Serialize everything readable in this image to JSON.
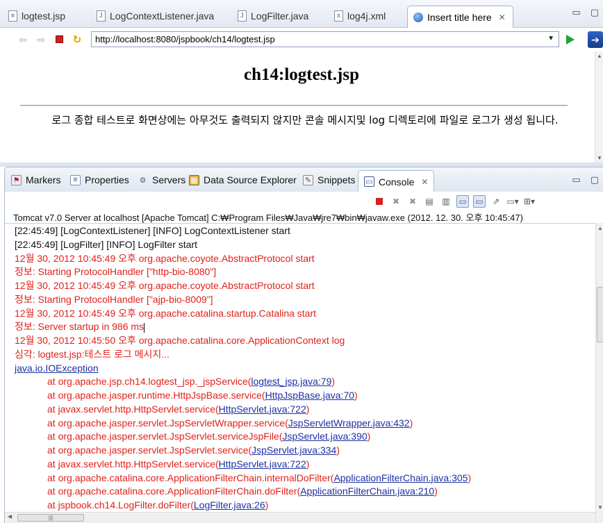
{
  "editor_tabs": [
    {
      "label": "logtest.jsp",
      "icon": "jsp-file-icon"
    },
    {
      "label": "LogContextListener.java",
      "icon": "java-file-icon"
    },
    {
      "label": "LogFilter.java",
      "icon": "java-file-icon"
    },
    {
      "label": "log4j.xml",
      "icon": "xml-file-icon"
    },
    {
      "label": "Insert title here",
      "icon": "globe-icon",
      "active": true
    }
  ],
  "browser": {
    "url": "http://localhost:8080/jspbook/ch14/logtest.jsp"
  },
  "web_page": {
    "title": "ch14:logtest.jsp",
    "message": "로그 종합 테스트로 화면상에는 아무것도 출력되지 않지만 콘솔 메시지및 log 디렉토리에 파일로 로그가 생성 됩니다."
  },
  "view_tabs": [
    {
      "label": "Markers",
      "icon": "markers-icon"
    },
    {
      "label": "Properties",
      "icon": "properties-icon"
    },
    {
      "label": "Servers",
      "icon": "servers-icon"
    },
    {
      "label": "Data Source Explorer",
      "icon": "data-source-icon"
    },
    {
      "label": "Snippets",
      "icon": "snippets-icon"
    },
    {
      "label": "Console",
      "icon": "console-icon",
      "active": true
    }
  ],
  "console": {
    "header": "Tomcat v7.0 Server at localhost [Apache Tomcat] C:₩Program Files₩Java₩jre7₩bin₩javaw.exe (2012. 12. 30. 오후 10:45:47)",
    "lines": [
      {
        "text": "[22:45:49] [LogContextListener] [INFO] LogContextListener start",
        "color": "black"
      },
      {
        "text": "[22:45:49] [LogFilter] [INFO] LogFilter start",
        "color": "black"
      },
      {
        "text": "12월 30, 2012 10:45:49 오후 org.apache.coyote.AbstractProtocol start",
        "color": "red"
      },
      {
        "text": "정보: Starting ProtocolHandler [\"http-bio-8080\"]",
        "color": "red"
      },
      {
        "text": "12월 30, 2012 10:45:49 오후 org.apache.coyote.AbstractProtocol start",
        "color": "red"
      },
      {
        "text": "정보: Starting ProtocolHandler [\"ajp-bio-8009\"]",
        "color": "red"
      },
      {
        "text": "12월 30, 2012 10:45:49 오후 org.apache.catalina.startup.Catalina start",
        "color": "red"
      },
      {
        "text": "정보: Server startup in 986 ms",
        "color": "red"
      },
      {
        "text": "12월 30, 2012 10:45:50 오후 org.apache.catalina.core.ApplicationContext log",
        "color": "red"
      },
      {
        "text": "심각: logtest.jsp:테스트 로그 메시지...",
        "color": "red"
      }
    ],
    "exception": "java.io.IOException",
    "stack": [
      {
        "prefix": "at org.apache.jsp.ch14.logtest_jsp._jspService(",
        "link": "logtest_jsp.java:79",
        "suffix": ")"
      },
      {
        "prefix": "at org.apache.jasper.runtime.HttpJspBase.service(",
        "link": "HttpJspBase.java:70",
        "suffix": ")"
      },
      {
        "prefix": "at javax.servlet.http.HttpServlet.service(",
        "link": "HttpServlet.java:722",
        "suffix": ")"
      },
      {
        "prefix": "at org.apache.jasper.servlet.JspServletWrapper.service(",
        "link": "JspServletWrapper.java:432",
        "suffix": ")"
      },
      {
        "prefix": "at org.apache.jasper.servlet.JspServlet.serviceJspFile(",
        "link": "JspServlet.java:390",
        "suffix": ")"
      },
      {
        "prefix": "at org.apache.jasper.servlet.JspServlet.service(",
        "link": "JspServlet.java:334",
        "suffix": ")"
      },
      {
        "prefix": "at javax.servlet.http.HttpServlet.service(",
        "link": "HttpServlet.java:722",
        "suffix": ")"
      },
      {
        "prefix": "at org.apache.catalina.core.ApplicationFilterChain.internalDoFilter(",
        "link": "ApplicationFilterChain.java:305",
        "suffix": ")"
      },
      {
        "prefix": "at org.apache.catalina.core.ApplicationFilterChain.doFilter(",
        "link": "ApplicationFilterChain.java:210",
        "suffix": ")"
      },
      {
        "prefix": "at jspbook.ch14.LogFilter.doFilter(",
        "link": "LogFilter.java:26",
        "suffix": ")"
      }
    ]
  },
  "colors": {
    "stderr_red": "#e0201b",
    "link_blue": "#1d2fa3",
    "stop_red": "#d52020",
    "go_green": "#1ea43a"
  }
}
